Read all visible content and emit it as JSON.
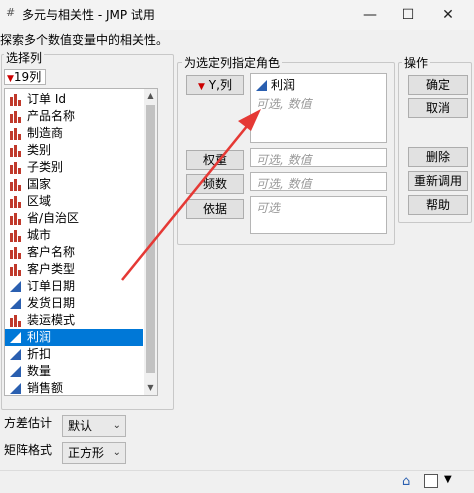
{
  "window": {
    "title": "多元与相关性 - JMP 试用",
    "min_glyph": "—",
    "max_glyph": "☐",
    "close_glyph": "✕"
  },
  "subtitle": "探索多个数值变量中的相关性。",
  "column_panel": {
    "label": "选择列",
    "count": "19列",
    "items": [
      {
        "label": "订单 Id",
        "type": "nominal"
      },
      {
        "label": "产品名称",
        "type": "nominal"
      },
      {
        "label": "制造商",
        "type": "nominal"
      },
      {
        "label": "类别",
        "type": "nominal"
      },
      {
        "label": "子类别",
        "type": "nominal"
      },
      {
        "label": "国家",
        "type": "nominal"
      },
      {
        "label": "区域",
        "type": "nominal"
      },
      {
        "label": "省/自治区",
        "type": "nominal"
      },
      {
        "label": "城市",
        "type": "nominal"
      },
      {
        "label": "客户名称",
        "type": "nominal"
      },
      {
        "label": "客户类型",
        "type": "nominal"
      },
      {
        "label": "订单日期",
        "type": "continuous"
      },
      {
        "label": "发货日期",
        "type": "continuous"
      },
      {
        "label": "装运模式",
        "type": "nominal"
      },
      {
        "label": "利润",
        "type": "continuous",
        "selected": true
      },
      {
        "label": "折扣",
        "type": "continuous"
      },
      {
        "label": "数量",
        "type": "continuous"
      },
      {
        "label": "销售额",
        "type": "continuous"
      }
    ]
  },
  "roles_panel": {
    "label": "为选定列指定角色",
    "y_button": "Y,列",
    "y_item": "利润",
    "y_placeholder": "可选, 数值",
    "weight_button": "权重",
    "weight_placeholder": "可选, 数值",
    "freq_button": "频数",
    "freq_placeholder": "可选, 数值",
    "by_button": "依据",
    "by_placeholder": "可选"
  },
  "action_panel": {
    "label": "操作",
    "ok": "确定",
    "cancel": "取消",
    "remove": "删除",
    "recall": "重新调用",
    "help": "帮助"
  },
  "options": {
    "variance_label": "方差估计",
    "variance_value": "默认",
    "matrix_label": "矩阵格式",
    "matrix_value": "正方形"
  },
  "colors": {
    "selection": "#0078d7",
    "nominal_icon": "#c0392b",
    "continuous_icon": "#2a5fb0",
    "arrow": "#e53935"
  }
}
